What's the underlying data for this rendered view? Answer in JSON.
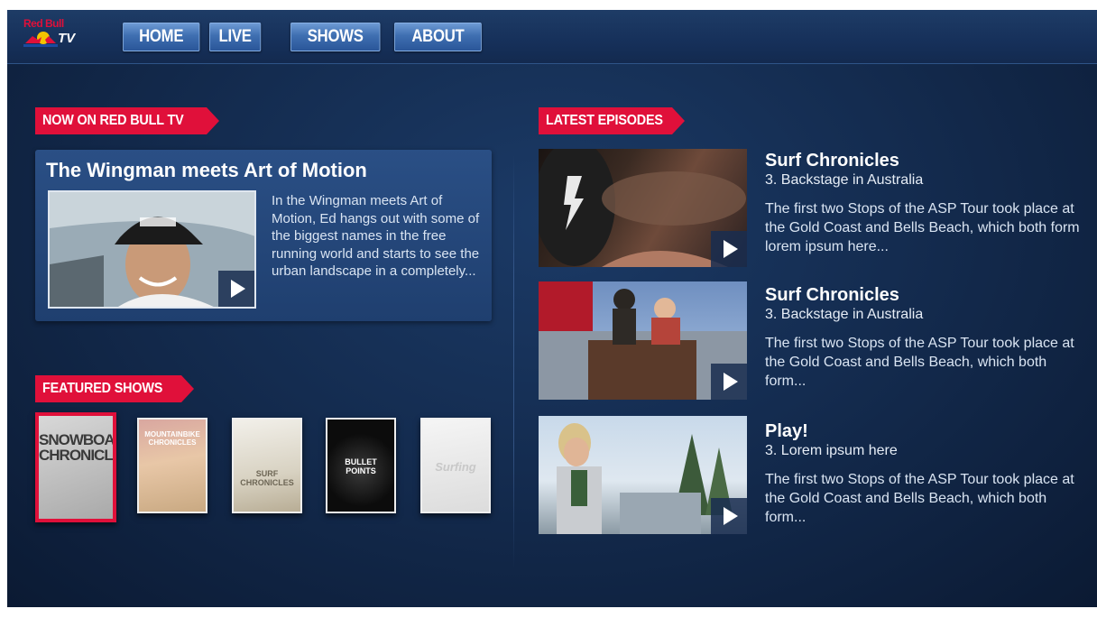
{
  "brand": {
    "logo_text": "Red Bull",
    "logo_tv": "TV"
  },
  "nav": {
    "items": [
      "HOME",
      "LIVE",
      "SHOWS",
      "ABOUT"
    ]
  },
  "now_on": {
    "heading": "NOW ON RED BULL TV",
    "title": "The Wingman meets Art of Motion",
    "description": "In the Wingman meets Art of Motion, Ed hangs out with some of the biggest names in the free running world and starts to see the urban landscape in a completely..."
  },
  "featured": {
    "heading": "FEATURED SHOWS",
    "shows": [
      {
        "label": "SNOWBOARD CHRONICLES",
        "selected": true
      },
      {
        "label": "MOUNTAINBIKE CHRONICLES",
        "selected": false
      },
      {
        "label": "SURF CHRONICLES",
        "selected": false
      },
      {
        "label": "BULLET POINTS",
        "selected": false
      },
      {
        "label": "Surfing",
        "selected": false
      }
    ]
  },
  "latest": {
    "heading": "LATEST EPISODES",
    "episodes": [
      {
        "title": "Surf Chronicles",
        "subtitle": "3. Backstage in Australia",
        "description": "The first two Stops of the ASP Tour took place at the Gold Coast and Bells Beach, which both form lorem ipsum here..."
      },
      {
        "title": "Surf Chronicles",
        "subtitle": "3. Backstage in Australia",
        "description": "The first two Stops of the ASP Tour took place at the Gold Coast and Bells Beach, which both form..."
      },
      {
        "title": "Play!",
        "subtitle": "3. Lorem ipsum here",
        "description": "The first two Stops of the ASP Tour took place at the Gold Coast and Bells Beach, which both form..."
      }
    ]
  },
  "colors": {
    "accent": "#e0103a",
    "background": "#142c50",
    "nav_button": "#3f6fb1"
  }
}
